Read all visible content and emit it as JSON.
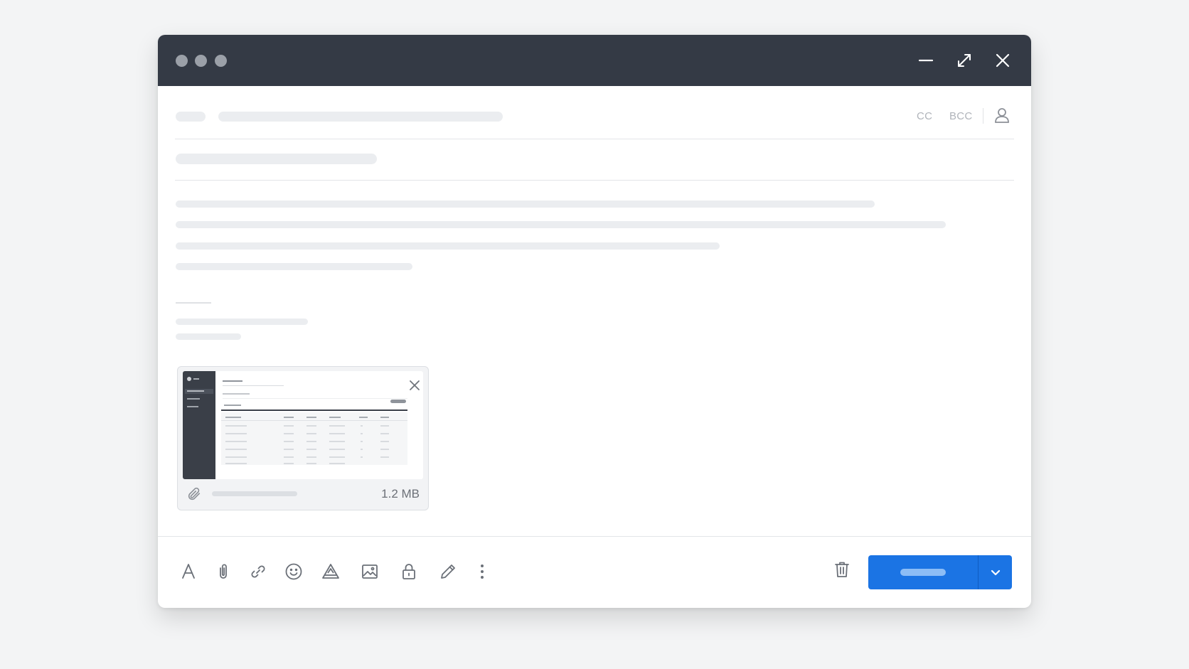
{
  "window": {
    "controls": {
      "minimize_icon": "minimize-icon",
      "expand_icon": "expand-icon",
      "close_icon": "close-icon"
    }
  },
  "header": {
    "cc_label": "CC",
    "bcc_label": "BCC",
    "contacts_icon": "person-icon"
  },
  "attachment": {
    "size": "1.2 MB",
    "icon": "paperclip-icon",
    "remove_icon": "close-icon"
  },
  "toolbar": {
    "icons": [
      "text-format-icon",
      "attach-icon",
      "link-icon",
      "emoji-icon",
      "drive-icon",
      "image-icon",
      "lock-icon",
      "signature-icon",
      "more-icon"
    ],
    "delete_icon": "trash-icon"
  },
  "send": {
    "label": "",
    "dropdown_icon": "chevron-down-icon"
  },
  "colors": {
    "titlebar": "#343a45",
    "accent": "#1b74e4",
    "background": "#f3f4f5"
  }
}
